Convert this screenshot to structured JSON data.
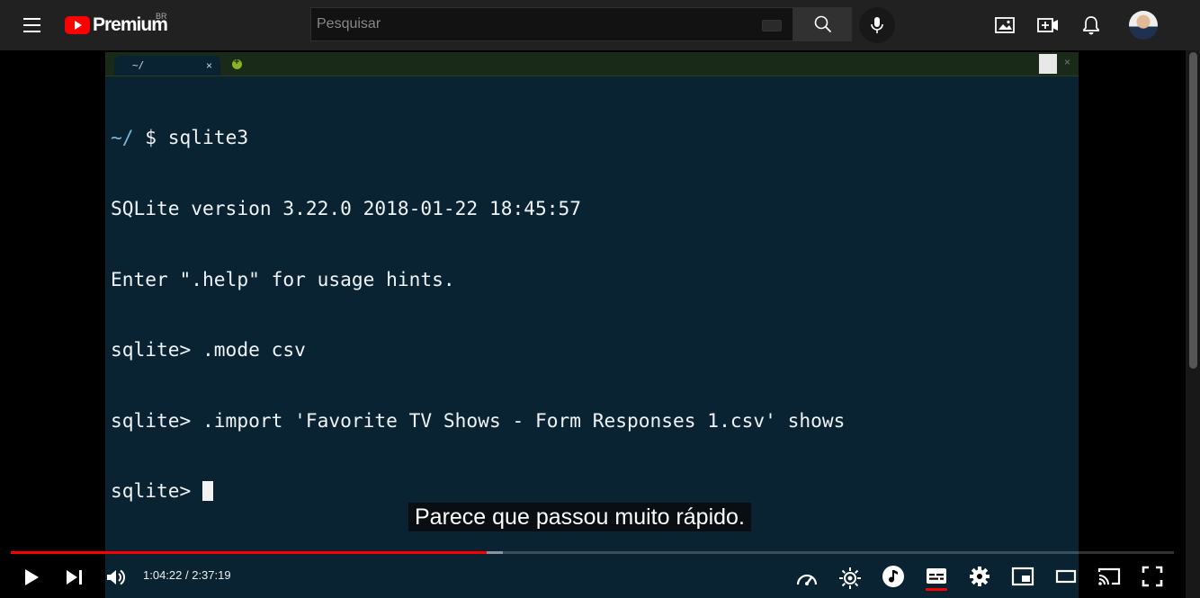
{
  "header": {
    "logo_text": "Premium",
    "region": "BR",
    "search_placeholder": "Pesquisar"
  },
  "terminal": {
    "tab_title": "~/",
    "tab_close": "×",
    "window_close": "×",
    "lines": [
      {
        "dir": "~/",
        "text": " $ sqlite3"
      },
      {
        "dir": "",
        "text": "SQLite version 3.22.0 2018-01-22 18:45:57"
      },
      {
        "dir": "",
        "text": "Enter \".help\" for usage hints."
      },
      {
        "dir": "",
        "text": "sqlite> .mode csv"
      },
      {
        "dir": "",
        "text": "sqlite> .import 'Favorite TV Shows - Form Responses 1.csv' shows"
      },
      {
        "dir": "",
        "text": "sqlite> "
      }
    ]
  },
  "video": {
    "caption": "Parece que passou muito rápido.",
    "current_time": "1:04:22",
    "duration": "2:37:19",
    "time_display": "1:04:22 / 2:37:19",
    "played_fraction": 0.409,
    "loaded_fraction": 0.423,
    "subtitles_on": true
  },
  "colors": {
    "progress_played": "#ff0000",
    "terminal_bg": "#0a2333",
    "masthead_bg": "#212121",
    "brand_red": "#ff0000"
  },
  "icons": {
    "masthead": [
      "menu-icon",
      "youtube-logo-icon",
      "keyboard-icon",
      "search-icon",
      "microphone-icon",
      "image-icon",
      "create-video-icon",
      "notifications-bell-icon",
      "avatar"
    ],
    "controls": [
      "play-icon",
      "next-icon",
      "volume-icon",
      "playback-speed-icon",
      "ambient-mode-icon",
      "music-note-icon",
      "subtitles-icon",
      "settings-gear-icon",
      "miniplayer-icon",
      "theater-mode-icon",
      "cast-icon",
      "fullscreen-icon"
    ]
  }
}
